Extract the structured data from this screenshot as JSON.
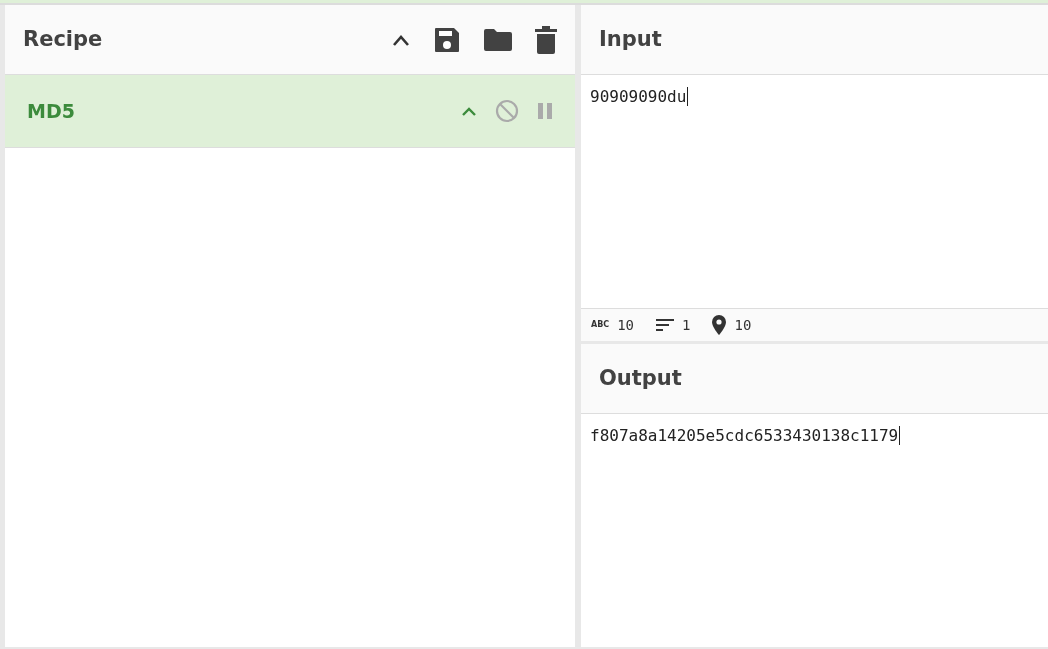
{
  "recipe": {
    "title": "Recipe",
    "operations": [
      {
        "name": "MD5",
        "disabled": false,
        "breakpoint": false
      }
    ]
  },
  "input": {
    "title": "Input",
    "value": "90909090du",
    "stats": [
      {
        "kind": "length",
        "icon_text": "ABC",
        "value": "10"
      },
      {
        "kind": "lines",
        "value": "1"
      },
      {
        "kind": "position",
        "value": "10"
      }
    ]
  },
  "output": {
    "title": "Output",
    "value": "f807a8a14205e5cdc6533430138c1179"
  }
}
